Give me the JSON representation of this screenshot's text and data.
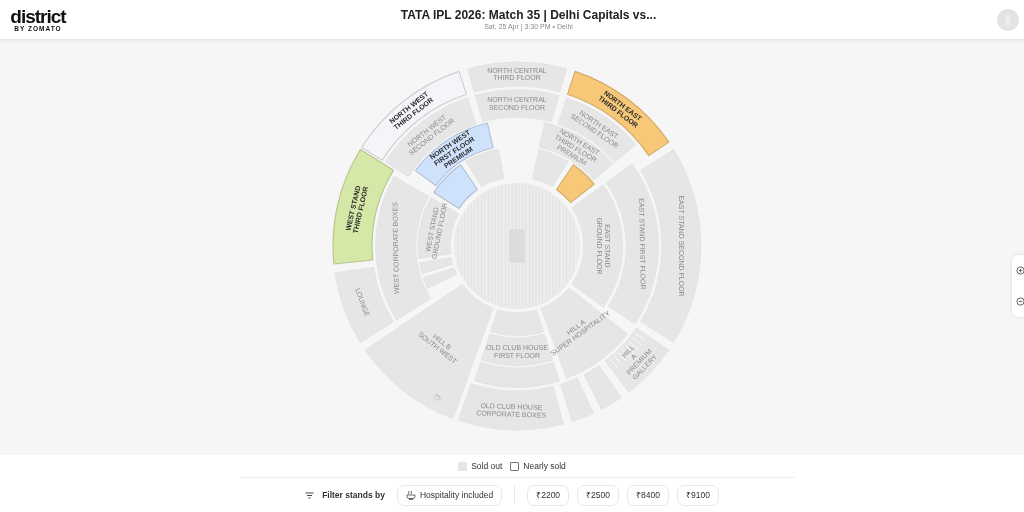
{
  "header": {
    "logo": "district",
    "logo_sub": "BY ZOMATO",
    "title": "TATA IPL 2026: Match 35 | Delhi Capitals vs...",
    "subtitle": "Sat, 25 Apr | 3:30 PM • Delhi"
  },
  "stadium": {
    "sections": [
      {
        "label": "NORTH WEST THIRD FLOOR",
        "sold_out": false,
        "color": "#f4f4f9"
      },
      {
        "label": "NORTH CENTRAL THIRD FLOOR",
        "sold_out": true
      },
      {
        "label": "NORTH EAST THIRD FLOOR",
        "sold_out": false,
        "color": "#f8c879"
      },
      {
        "label": "NORTH WEST SECOND FLOOR",
        "sold_out": true
      },
      {
        "label": "NORTH CENTRAL SECOND FLOOR",
        "sold_out": true
      },
      {
        "label": "NORTH EAST SECOND FLOOR",
        "sold_out": true
      },
      {
        "label": "NORTH WEST FIRST FLOOR PREMIUM",
        "sold_out": false,
        "color": "#cfe2fb"
      },
      {
        "sold_out": false,
        "color": "#cfe2fb"
      },
      {
        "sold_out": true
      },
      {
        "label": "NORTH EAST THIRD FLOOR PREMIUM",
        "sold_out": true
      },
      {
        "sold_out": true
      },
      {
        "sold_out": false,
        "color": "#f8c879"
      },
      {
        "label": "EAST STAND SECOND FLOOR",
        "sold_out": true
      },
      {
        "label": "EAST STAND FIRST FLOOR",
        "sold_out": true
      },
      {
        "label": "EAST STAND GROUND FLOOR",
        "sold_out": true
      },
      {
        "label": "HILL A PREMIUM GALLERY",
        "sold_out": true,
        "kind": "gallery"
      },
      {
        "label": "HILL A SUPER HOSPITALITY",
        "sold_out": true
      },
      {
        "sold_out": true
      },
      {
        "sold_out": true
      },
      {
        "sold_out": true
      },
      {
        "label": "OLD CLUB HOUSE FIRST FLOOR",
        "sold_out": true
      },
      {
        "sold_out": true
      },
      {
        "label": "OLD CLUB HOUSE CORPORATE BOXES",
        "sold_out": true
      },
      {
        "label": "HILL B SOUTH WEST",
        "sold_out": true,
        "kind": "accessible"
      },
      {
        "label": "LOUNGE",
        "sold_out": true
      },
      {
        "label": "WEST CORPORATE BOXES",
        "sold_out": true
      },
      {
        "label": "WEST STAND GROUND FLOOR",
        "sold_out": true
      },
      {
        "sold_out": true
      },
      {
        "sold_out": true
      },
      {
        "label": "WEST STAND THIRD FLOOR",
        "sold_out": false,
        "color": "#d6e8a8"
      }
    ]
  },
  "legend": [
    {
      "label": "Sold out",
      "kind": "sold_out"
    },
    {
      "label": "Nearly sold",
      "kind": "nearly_sold"
    }
  ],
  "filters": {
    "label": "Filter stands by",
    "chips": [
      {
        "label": "Hospitality included",
        "kind": "hospitality"
      },
      {
        "label": "₹2200",
        "kind": "price"
      },
      {
        "label": "₹2500",
        "kind": "price"
      },
      {
        "label": "₹8400",
        "kind": "price"
      },
      {
        "label": "₹9100",
        "kind": "price"
      }
    ]
  }
}
